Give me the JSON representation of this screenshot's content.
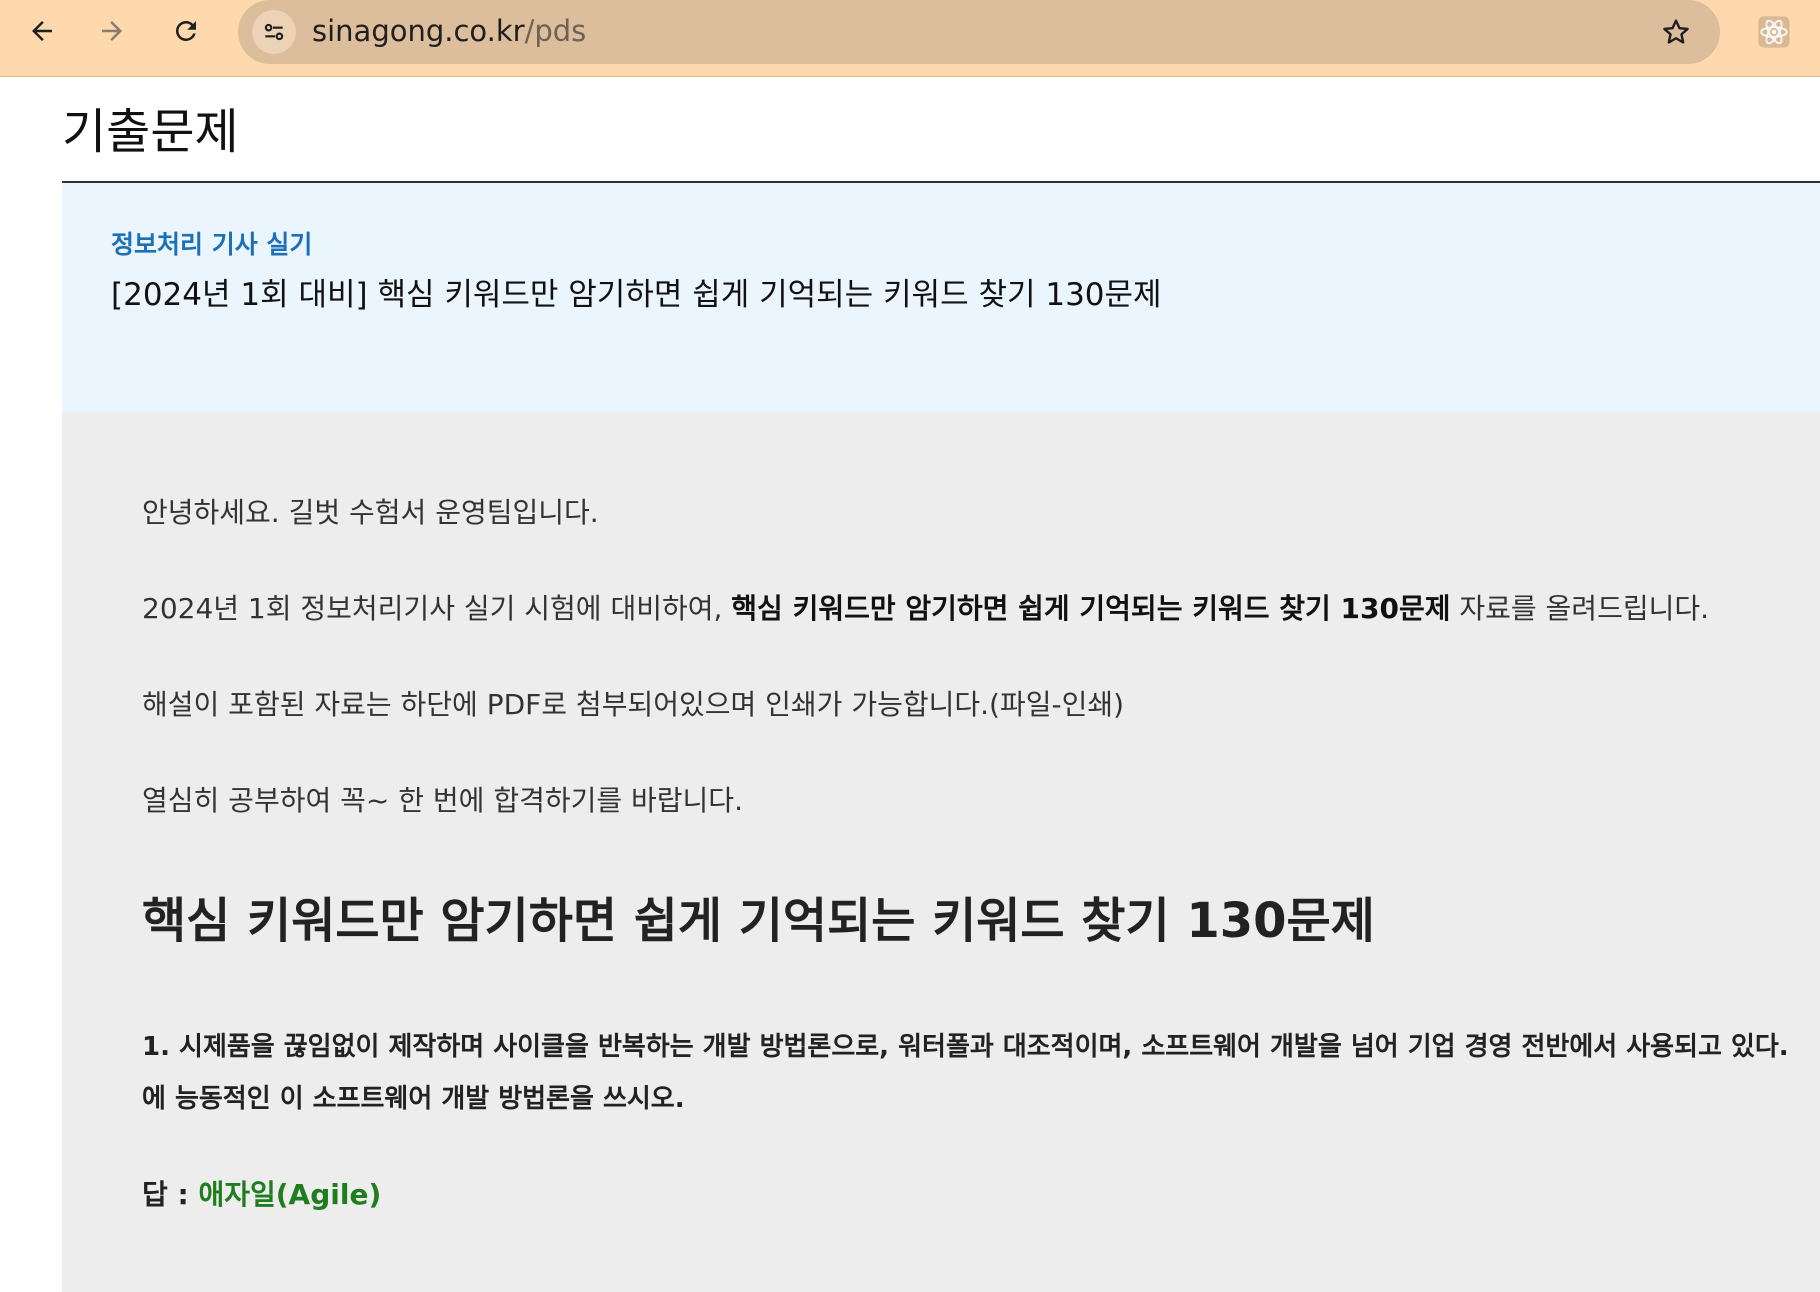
{
  "browser": {
    "url_host": "sinagong.co.kr",
    "url_path": "/pds",
    "icons": [
      "back-arrow-icon",
      "forward-arrow-icon",
      "reload-icon",
      "site-info-icon",
      "bookmark-star-icon",
      "react-extension-icon"
    ]
  },
  "page": {
    "title": "기출문제"
  },
  "post": {
    "category": "정보처리 기사 실기",
    "title": "[2024년 1회 대비] 핵심 키워드만 암기하면 쉽게 기억되는 키워드 찾기 130문제"
  },
  "body": {
    "greeting": "안녕하세요. 길벗 수험서 운영팀입니다.",
    "intro_prefix": "2024년 1회 정보처리기사 실기 시험에 대비하여, ",
    "intro_bold": "핵심 키워드만 암기하면 쉽게 기억되는 키워드 찾기 130문제",
    "intro_suffix": " 자료를 올려드립니다.",
    "attachment_note": "해설이 포함된 자료는 하단에 PDF로 첨부되어있으며 인쇄가 가능합니다.(파일-인쇄)",
    "closing": "열심히 공부하여 꼭~ 한 번에 합격하기를 바랍니다.",
    "heading": "핵심 키워드만 암기하면 쉽게 기억되는 키워드 찾기 130문제",
    "question_line1": "1. 시제품을 끊임없이 제작하며 사이클을 반복하는 개발 방법론으로, 워터폴과 대조적이며, 소프트웨어 개발을 넘어 기업 경영 전반에서 사용되고 있다.",
    "question_line2": "에 능동적인 이 소프트웨어 개발 방법론을 쓰시오.",
    "answer_label": "답 : ",
    "answer_value": "애자일(Agile)"
  },
  "colors": {
    "toolbar": "#fdd9ad",
    "omnibox": "#dcbd9c",
    "post_head_bg": "#ebf5fd",
    "category_blue": "#1d6fb8",
    "body_bg": "#ededed",
    "answer_green": "#1f7d1f"
  }
}
